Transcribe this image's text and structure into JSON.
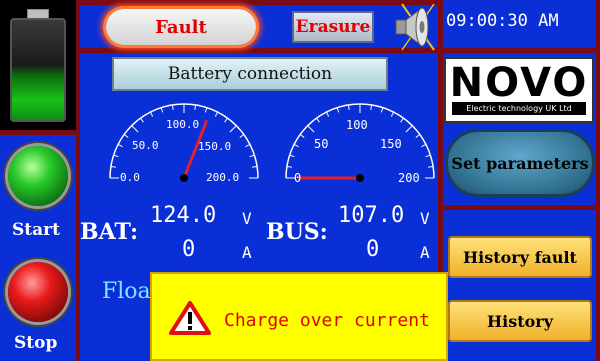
{
  "header": {
    "fault_label": "Fault",
    "erasure_label": "Erasure",
    "clock": "09:00:30 AM",
    "speaker_icon": "speaker-icon"
  },
  "connection": {
    "label": "Battery connection"
  },
  "brand": {
    "logo_word": "NOVO",
    "logo_tagline": "Electric technology UK Ltd"
  },
  "controls": {
    "start_label": "Start",
    "stop_label": "Stop",
    "set_params_label": "Set parameters",
    "history_fault_label": "History  fault",
    "history_label": "History"
  },
  "gauges": {
    "bat": {
      "ticks": [
        "0.0",
        "50.0",
        "100.0",
        "150.0",
        "200.0"
      ],
      "min": 0,
      "max": 200,
      "value": 124
    },
    "bus": {
      "ticks": [
        "0",
        "50",
        "100",
        "150",
        "200"
      ],
      "min": 0,
      "max": 200,
      "value": 0
    }
  },
  "readouts": {
    "bat_label": "BAT:",
    "bat_voltage": "124.0",
    "bat_current": "0",
    "bus_label": "BUS:",
    "bus_voltage": "107.0",
    "bus_current": "0",
    "unit_v": "V",
    "unit_a": "A"
  },
  "status": {
    "mode_text": "Floa"
  },
  "alert": {
    "message": "Charge over current",
    "icon": "warning-icon"
  },
  "colors": {
    "background": "#0a2fd6",
    "frame": "#7a0a14",
    "alert_bg": "#ffff00",
    "alert_text": "#e00000"
  }
}
